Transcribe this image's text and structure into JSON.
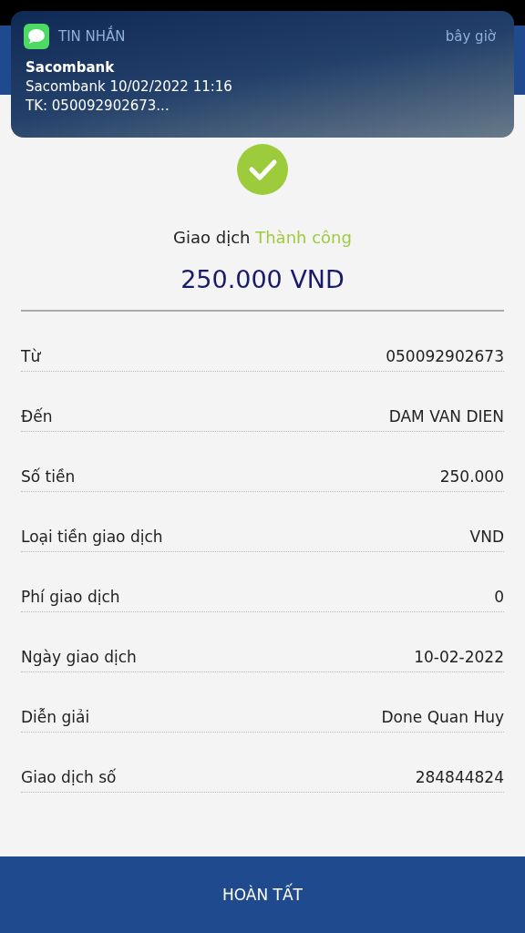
{
  "notification": {
    "app": "TIN NHẮN",
    "time": "bây giờ",
    "sender": "Sacombank",
    "lines": [
      "Sacombank 10/02/2022 11:16",
      "TK: 050092902673..."
    ]
  },
  "status": {
    "prefix": "Giao dịch",
    "result": "Thành công"
  },
  "amount": "250.000 VND",
  "details": [
    {
      "label": "Từ",
      "value": "050092902673"
    },
    {
      "label": "Đến",
      "value": "DAM VAN DIEN"
    },
    {
      "label": "Số tiền",
      "value": "250.000"
    },
    {
      "label": "Loại tiền giao dịch",
      "value": "VND"
    },
    {
      "label": "Phí giao dịch",
      "value": "0"
    },
    {
      "label": "Ngày giao dịch",
      "value": "10-02-2022"
    },
    {
      "label": "Diễn giải",
      "value": "Done Quan Huy"
    },
    {
      "label": "Giao dịch số",
      "value": "284844824"
    }
  ],
  "button": "HOÀN TẤT"
}
